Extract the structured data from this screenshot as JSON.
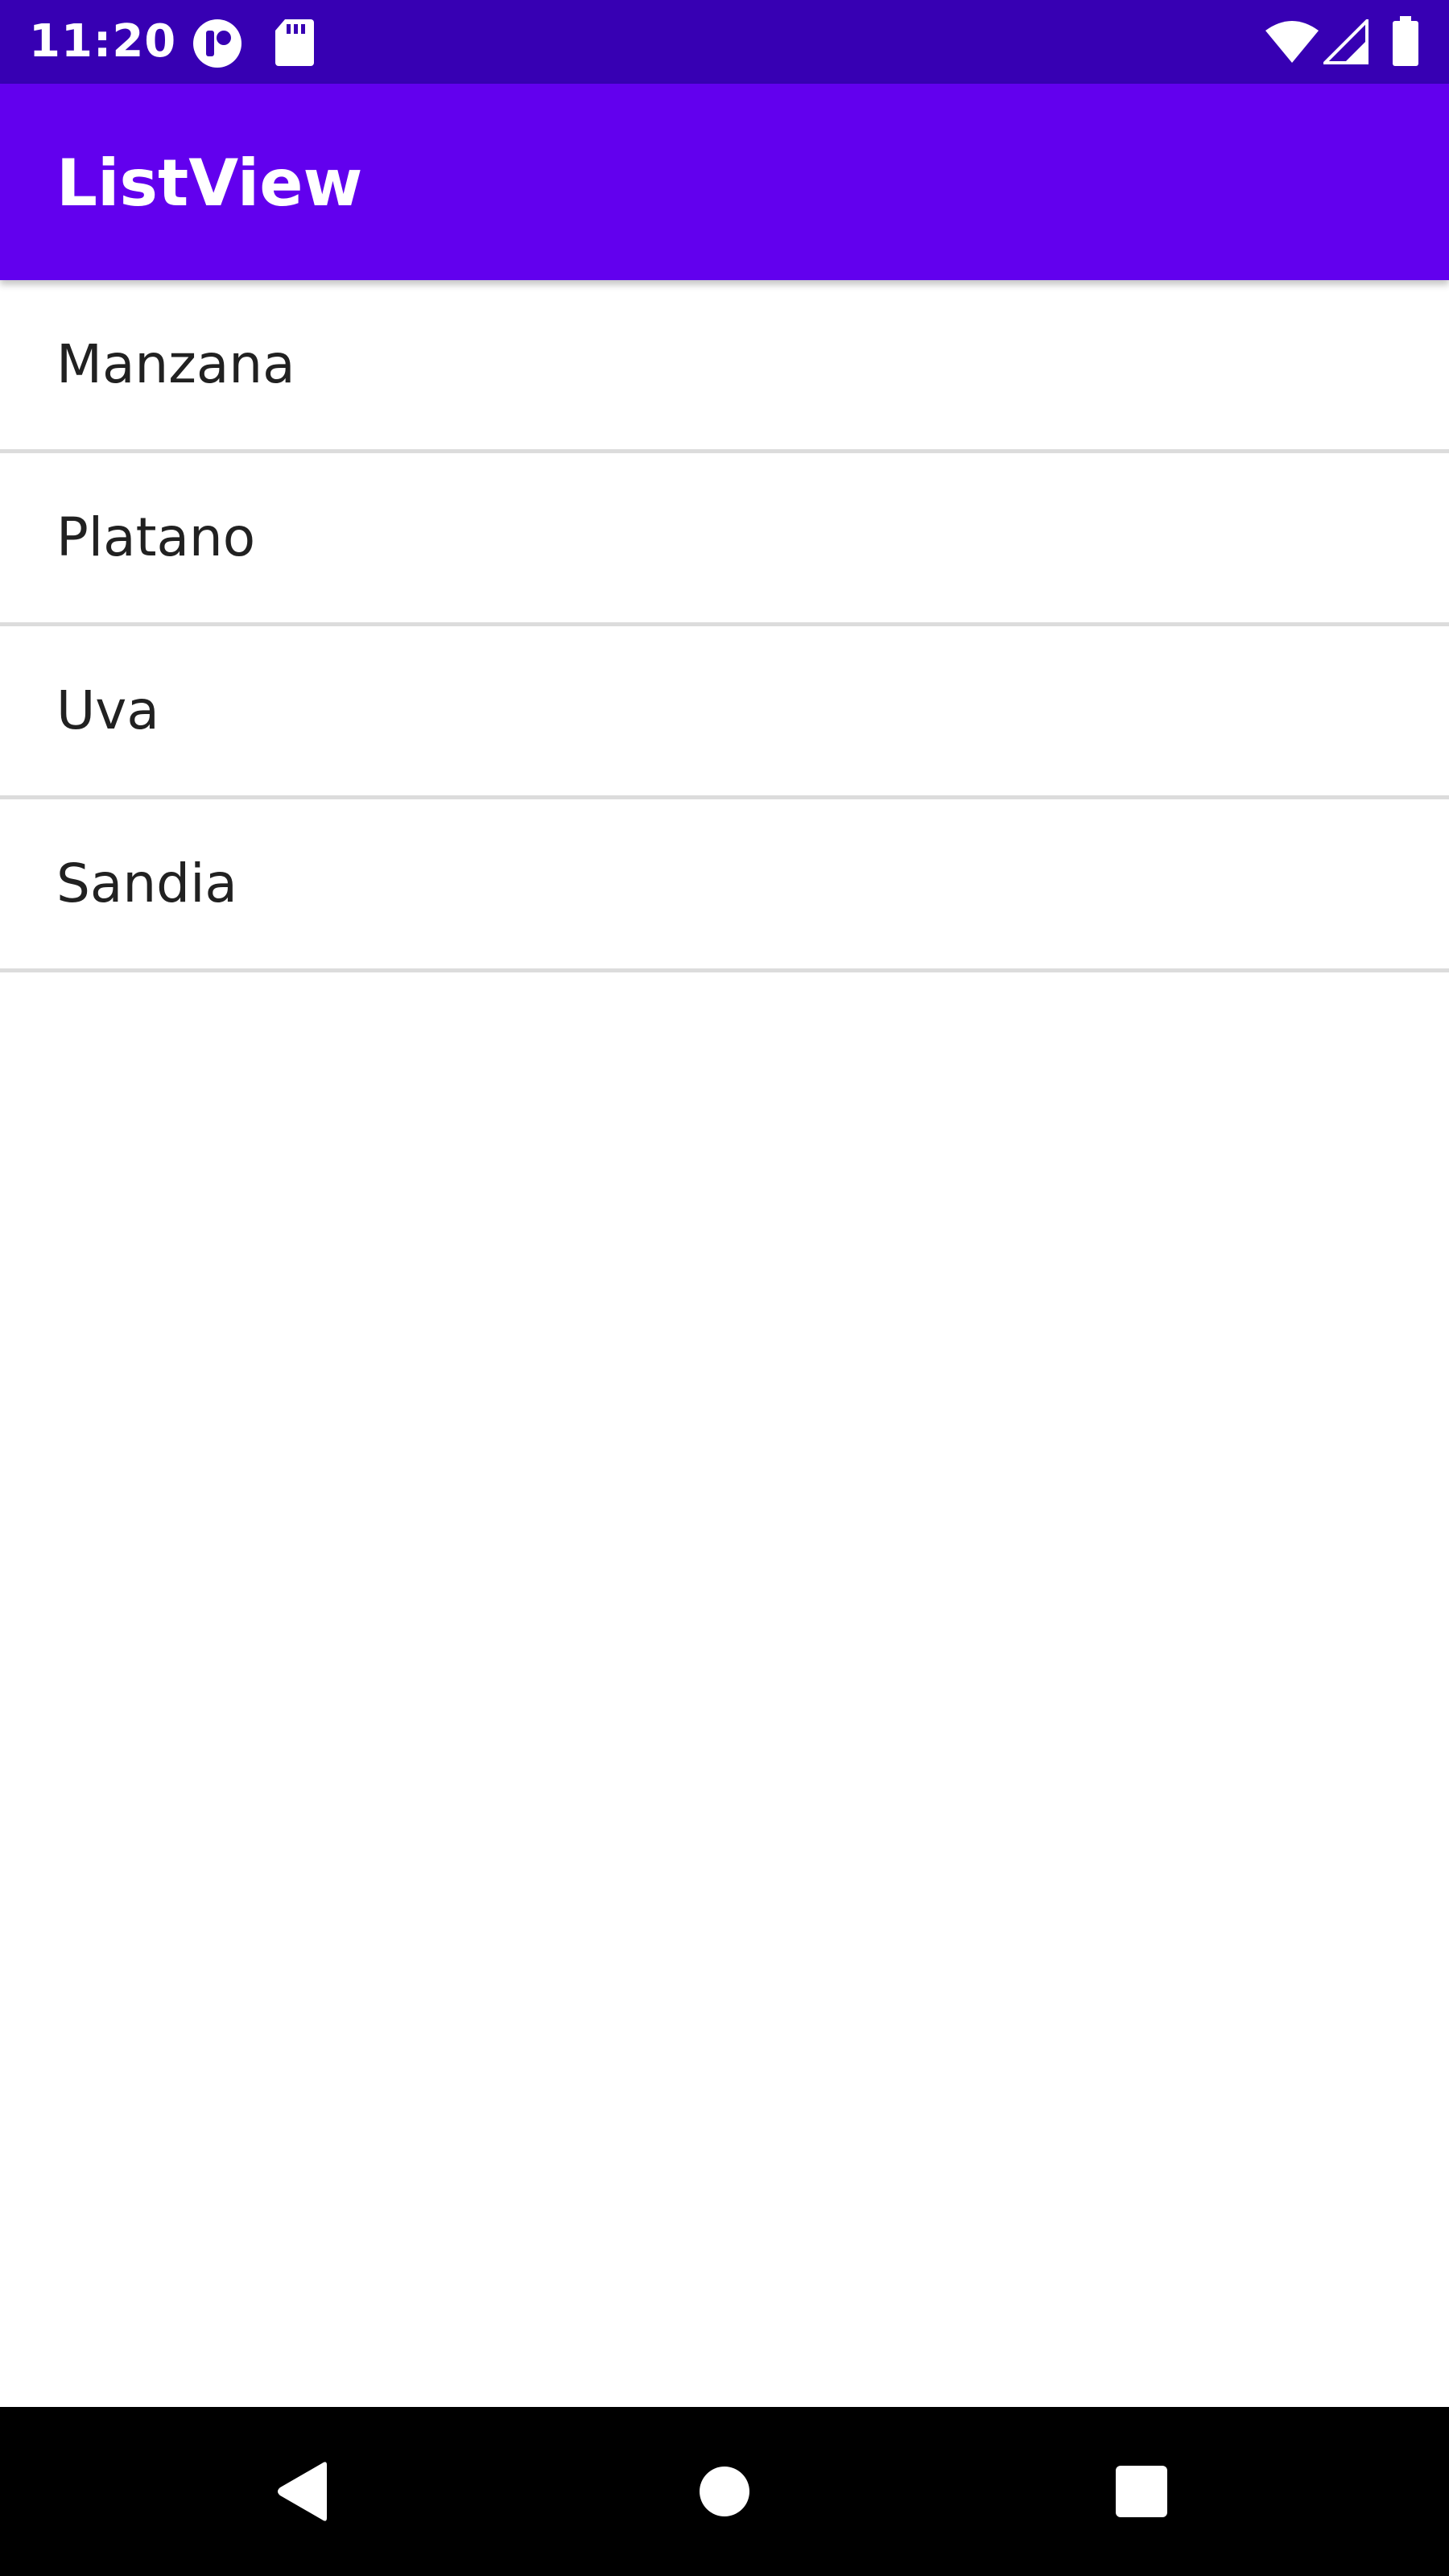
{
  "status_bar": {
    "time": "11:20",
    "icons": [
      "app-notification-icon",
      "sd-card-icon",
      "wifi-icon",
      "cellular-signal-icon",
      "battery-icon"
    ],
    "background_color": "#3700b3"
  },
  "app_bar": {
    "title": "ListView",
    "background_color": "#6200ee"
  },
  "list": {
    "items": [
      {
        "label": "Manzana"
      },
      {
        "label": "Platano"
      },
      {
        "label": "Uva"
      },
      {
        "label": "Sandia"
      }
    ]
  },
  "nav_bar": {
    "buttons": [
      "back-icon",
      "home-icon",
      "recents-icon"
    ]
  }
}
